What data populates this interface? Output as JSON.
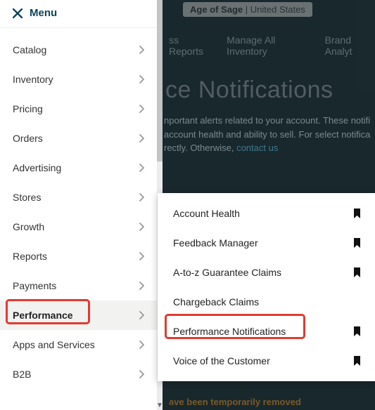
{
  "brand": {
    "name": "Age of Sage",
    "country": "United States"
  },
  "topnav": {
    "item1": "ss Reports",
    "item2": "Manage All Inventory",
    "item3": "Brand Analyt"
  },
  "page": {
    "title": "ce Notifications",
    "desc1": "nportant alerts related to your account. These notifi",
    "desc2": "account health and ability to sell. For select notifica",
    "desc3": "rectly. Otherwise, ",
    "contact": "contact us",
    "removed": "ave been temporarily removed"
  },
  "sidebar": {
    "menu_label": "Menu",
    "items": [
      {
        "label": "Catalog"
      },
      {
        "label": "Inventory"
      },
      {
        "label": "Pricing"
      },
      {
        "label": "Orders"
      },
      {
        "label": "Advertising"
      },
      {
        "label": "Stores"
      },
      {
        "label": "Growth"
      },
      {
        "label": "Reports"
      },
      {
        "label": "Payments"
      },
      {
        "label": "Performance",
        "active": true
      },
      {
        "label": "Apps and Services"
      },
      {
        "label": "B2B"
      }
    ]
  },
  "submenu": {
    "items": [
      {
        "label": "Account Health",
        "bookmark": true
      },
      {
        "label": "Feedback Manager",
        "bookmark": true
      },
      {
        "label": "A-to-z Guarantee Claims",
        "bookmark": true
      },
      {
        "label": "Chargeback Claims",
        "bookmark": false
      },
      {
        "label": "Performance Notifications",
        "bookmark": true,
        "highlight": true
      },
      {
        "label": "Voice of the Customer",
        "bookmark": true
      }
    ]
  }
}
